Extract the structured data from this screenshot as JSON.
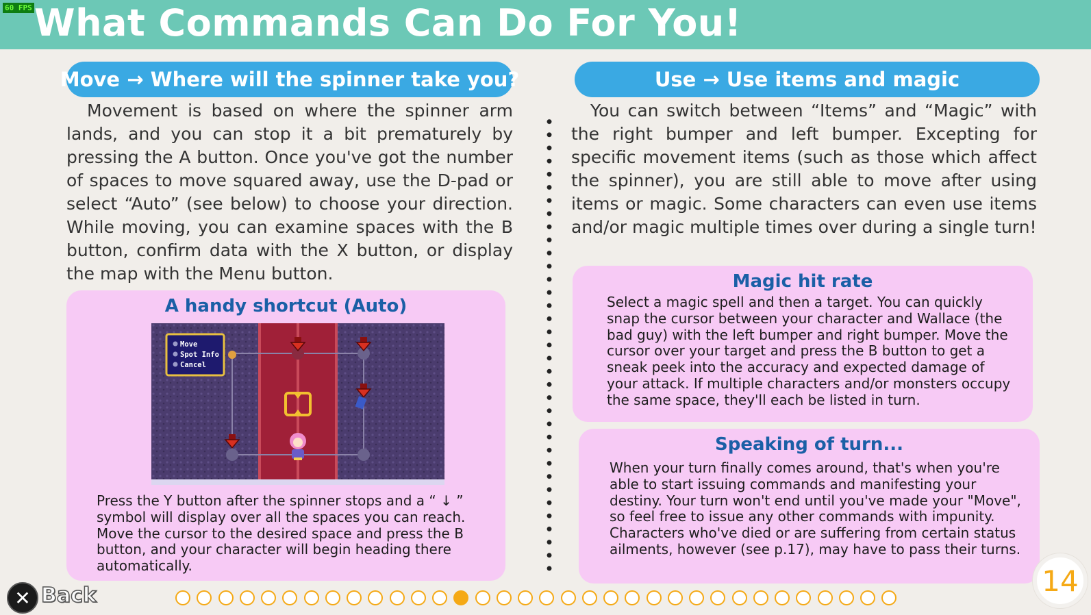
{
  "fps": "60 FPS",
  "title": "What Commands Can Do For You!",
  "left": {
    "heading": "Move → Where will the spinner take you?",
    "paragraph": "Movement is based on where the spinner arm lands, and you can stop it a bit prematurely by pressing the A button. Once you've got the number of spaces to move squared away, use the D-pad or select “Auto” (see below) to choose your direction. While moving, you can examine spaces with the B button, confirm data with the X button, or display the map with the Menu button.",
    "shortcut": {
      "title": "A handy shortcut (Auto)",
      "menu_items": [
        "Move",
        "Spot Info",
        "Cancel"
      ],
      "text": "Press the Y button after the spinner stops and a “ ↓ ” symbol will display over all the spaces you can reach. Move the cursor to the desired space and press the B button, and your character will begin heading there automatically."
    }
  },
  "right": {
    "heading": "Use → Use items and magic",
    "paragraph": "You can switch between “Items” and “Magic” with the right bumper and left bumper. Excepting for specific movement items (such as those which affect the spinner), you are still able to move after using items or magic. Some characters can even use items and/or magic multiple times over during a single turn!",
    "magic": {
      "title": "Magic hit rate",
      "text": "Select a magic spell and then a target. You can quickly snap the cursor between your character and Wallace (the bad guy) with the left bumper and right bumper. Move the cursor over your target and press the B button to get a sneak peek into the accuracy and expected damage of your attack. If multiple characters and/or monsters occupy the same space, they'll each be listed in turn."
    },
    "speaking": {
      "title": "Speaking of turn...",
      "text": "When your turn finally comes around, that's when you're able to start issuing commands and manifesting your destiny. Your turn won't end until you've made your \"Move\", so feel free to issue any other commands with impunity. Characters who've died or are suffering from certain status ailments, however (see p.17), may have to pass their turns."
    }
  },
  "footer": {
    "back_icon": "x-button-icon",
    "back_label": "Back",
    "page_number": "14",
    "total_pages": 34,
    "current_page_index": 13
  },
  "colors": {
    "header": "#6cc8b6",
    "pill": "#3aa9e3",
    "box": "#f7caf5",
    "box_title": "#1a5fa6",
    "accent": "#f5a915"
  }
}
